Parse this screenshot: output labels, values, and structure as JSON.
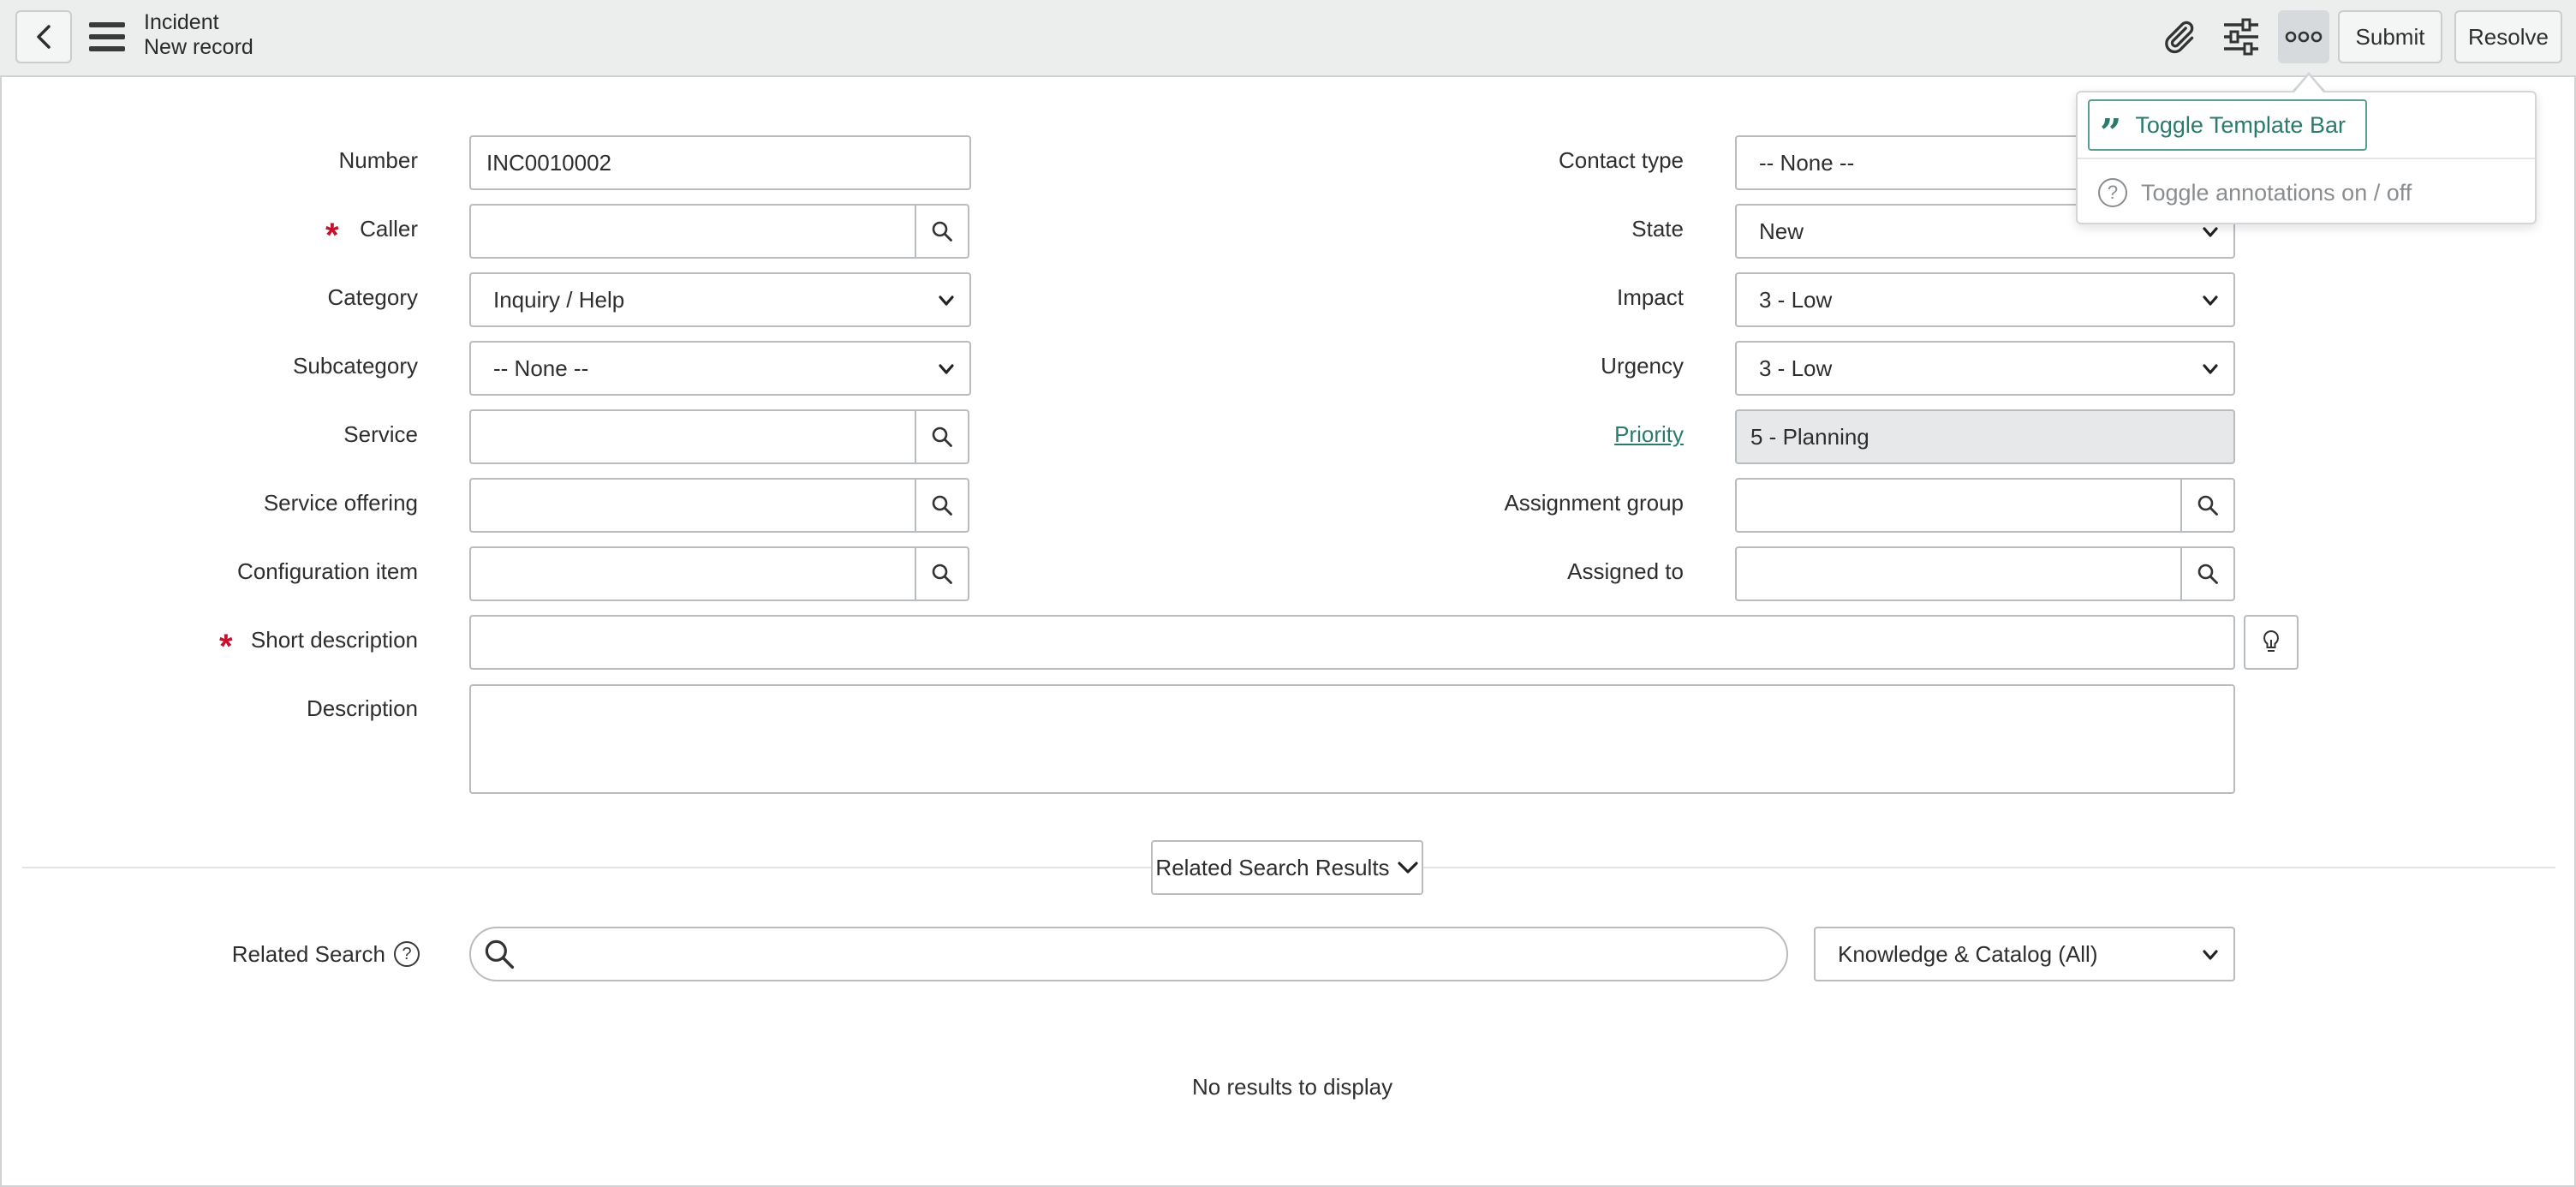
{
  "header": {
    "title": "Incident",
    "subtitle": "New record",
    "submit_label": "Submit",
    "resolve_label": "Resolve"
  },
  "more_menu": {
    "items": [
      {
        "label": "Toggle Template Bar"
      },
      {
        "label": "Toggle annotations on / off"
      }
    ]
  },
  "form": {
    "left": {
      "number_label": "Number",
      "number_value": "INC0010002",
      "caller_label": "Caller",
      "caller_value": "",
      "category_label": "Category",
      "category_value": "Inquiry / Help",
      "subcategory_label": "Subcategory",
      "subcategory_value": "-- None --",
      "service_label": "Service",
      "service_value": "",
      "service_offering_label": "Service offering",
      "service_offering_value": "",
      "configuration_item_label": "Configuration item",
      "configuration_item_value": ""
    },
    "right": {
      "contact_type_label": "Contact type",
      "contact_type_value": "-- None --",
      "state_label": "State",
      "state_value": "New",
      "impact_label": "Impact",
      "impact_value": "3 - Low",
      "urgency_label": "Urgency",
      "urgency_value": "3 - Low",
      "priority_label": "Priority",
      "priority_value": "5 - Planning",
      "assignment_group_label": "Assignment group",
      "assignment_group_value": "",
      "assigned_to_label": "Assigned to",
      "assigned_to_value": ""
    },
    "short_description_label": "Short description",
    "short_description_value": "",
    "description_label": "Description",
    "description_value": ""
  },
  "related": {
    "results_button_label": "Related Search Results",
    "search_label": "Related Search",
    "search_value": "",
    "scope_value": "Knowledge & Catalog (All)",
    "empty_text": "No results to display"
  },
  "colors": {
    "accent": "#2b7a6e",
    "required": "#c8102e",
    "header_bg": "#eceded"
  }
}
